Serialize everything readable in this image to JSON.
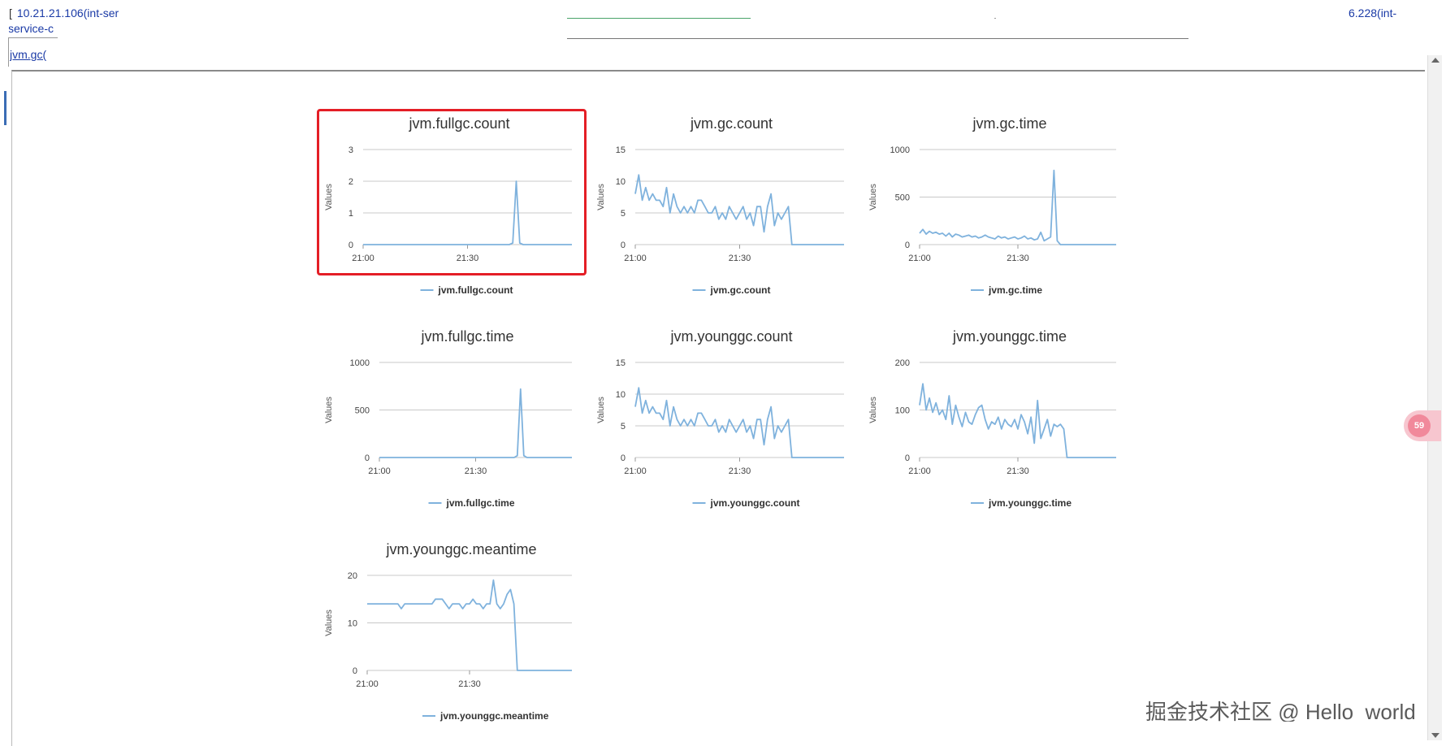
{
  "header": {
    "host_left_bracket": "[",
    "host_left_line1": "10.21.21.106(int-ser",
    "host_left_line2": "service-c",
    "host_right": "6.228(int-",
    "tab_label": "jvm.gc(",
    "side_badge": "59"
  },
  "watermark": "掘金技术社区 @ Hello_world_",
  "colors": {
    "series": "#7fb2dd",
    "grid": "#c8c8c8",
    "highlight": "#e41e26",
    "link": "#1a3aa6"
  },
  "icons": {
    "scroll_up": "triangle-up-icon",
    "scroll_down": "triangle-down-icon",
    "legend": "line-swatch-icon"
  },
  "chart_data": [
    {
      "type": "line",
      "title": "jvm.fullgc.count",
      "ylabel": "Values",
      "legend": "jvm.fullgc.count",
      "ylim": [
        0,
        3
      ],
      "yticks": [
        0,
        1,
        2,
        3
      ],
      "xlim": [
        0,
        60
      ],
      "xticks": [
        "21:00",
        "21:30"
      ],
      "xtick_pos": [
        0,
        30
      ],
      "x": [
        0,
        42,
        43,
        44,
        45,
        46,
        60
      ],
      "values": [
        0,
        0,
        0.05,
        2,
        0.05,
        0,
        0
      ]
    },
    {
      "type": "line",
      "title": "jvm.gc.count",
      "ylabel": "Values",
      "legend": "jvm.gc.count",
      "ylim": [
        0,
        15
      ],
      "yticks": [
        0,
        5,
        10,
        15
      ],
      "xlim": [
        0,
        60
      ],
      "xticks": [
        "21:00",
        "21:30"
      ],
      "xtick_pos": [
        0,
        30
      ],
      "x": [
        0,
        1,
        2,
        3,
        4,
        5,
        6,
        7,
        8,
        9,
        10,
        11,
        12,
        13,
        14,
        15,
        16,
        17,
        18,
        19,
        20,
        21,
        22,
        23,
        24,
        25,
        26,
        27,
        28,
        29,
        30,
        31,
        32,
        33,
        34,
        35,
        36,
        37,
        38,
        39,
        40,
        41,
        42,
        43,
        44,
        45,
        60
      ],
      "values": [
        8,
        11,
        7,
        9,
        7,
        8,
        7,
        7,
        6,
        9,
        5,
        8,
        6,
        5,
        6,
        5,
        6,
        5,
        7,
        7,
        6,
        5,
        5,
        6,
        4,
        5,
        4,
        6,
        5,
        4,
        5,
        6,
        4,
        5,
        3,
        6,
        6,
        2,
        6,
        8,
        3,
        5,
        4,
        5,
        6,
        0,
        0
      ]
    },
    {
      "type": "line",
      "title": "jvm.gc.time",
      "ylabel": "Values",
      "legend": "jvm.gc.time",
      "ylim": [
        0,
        1000
      ],
      "yticks": [
        0,
        500,
        1000
      ],
      "xlim": [
        0,
        60
      ],
      "xticks": [
        "21:00",
        "21:30"
      ],
      "xtick_pos": [
        0,
        30
      ],
      "x": [
        0,
        1,
        2,
        3,
        4,
        5,
        6,
        7,
        8,
        9,
        10,
        11,
        12,
        13,
        14,
        15,
        16,
        17,
        18,
        19,
        20,
        21,
        22,
        23,
        24,
        25,
        26,
        27,
        28,
        29,
        30,
        31,
        32,
        33,
        34,
        35,
        36,
        37,
        38,
        39,
        40,
        41,
        42,
        43,
        60
      ],
      "values": [
        120,
        160,
        110,
        140,
        120,
        130,
        110,
        120,
        90,
        120,
        80,
        110,
        100,
        80,
        90,
        100,
        80,
        90,
        70,
        80,
        100,
        80,
        70,
        60,
        90,
        70,
        80,
        60,
        70,
        80,
        60,
        70,
        90,
        60,
        70,
        50,
        60,
        130,
        40,
        60,
        80,
        780,
        40,
        0,
        0
      ]
    },
    {
      "type": "line",
      "title": "jvm.fullgc.time",
      "ylabel": "Values",
      "legend": "jvm.fullgc.time",
      "ylim": [
        0,
        1000
      ],
      "yticks": [
        0,
        500,
        1000
      ],
      "xlim": [
        0,
        60
      ],
      "xticks": [
        "21:00",
        "21:30"
      ],
      "xtick_pos": [
        0,
        30
      ],
      "x": [
        0,
        42,
        43,
        44,
        45,
        46,
        60
      ],
      "values": [
        0,
        0,
        20,
        720,
        20,
        0,
        0
      ]
    },
    {
      "type": "line",
      "title": "jvm.younggc.count",
      "ylabel": "Values",
      "legend": "jvm.younggc.count",
      "ylim": [
        0,
        15
      ],
      "yticks": [
        0,
        5,
        10,
        15
      ],
      "xlim": [
        0,
        60
      ],
      "xticks": [
        "21:00",
        "21:30"
      ],
      "xtick_pos": [
        0,
        30
      ],
      "x": [
        0,
        1,
        2,
        3,
        4,
        5,
        6,
        7,
        8,
        9,
        10,
        11,
        12,
        13,
        14,
        15,
        16,
        17,
        18,
        19,
        20,
        21,
        22,
        23,
        24,
        25,
        26,
        27,
        28,
        29,
        30,
        31,
        32,
        33,
        34,
        35,
        36,
        37,
        38,
        39,
        40,
        41,
        42,
        43,
        44,
        45,
        60
      ],
      "values": [
        8,
        11,
        7,
        9,
        7,
        8,
        7,
        7,
        6,
        9,
        5,
        8,
        6,
        5,
        6,
        5,
        6,
        5,
        7,
        7,
        6,
        5,
        5,
        6,
        4,
        5,
        4,
        6,
        5,
        4,
        5,
        6,
        4,
        5,
        3,
        6,
        6,
        2,
        6,
        8,
        3,
        5,
        4,
        5,
        6,
        0,
        0
      ]
    },
    {
      "type": "line",
      "title": "jvm.younggc.time",
      "ylabel": "Values",
      "legend": "jvm.younggc.time",
      "ylim": [
        0,
        200
      ],
      "yticks": [
        0,
        100,
        200
      ],
      "xlim": [
        0,
        60
      ],
      "xticks": [
        "21:00",
        "21:30"
      ],
      "xtick_pos": [
        0,
        30
      ],
      "x": [
        0,
        1,
        2,
        3,
        4,
        5,
        6,
        7,
        8,
        9,
        10,
        11,
        12,
        13,
        14,
        15,
        16,
        17,
        18,
        19,
        20,
        21,
        22,
        23,
        24,
        25,
        26,
        27,
        28,
        29,
        30,
        31,
        32,
        33,
        34,
        35,
        36,
        37,
        38,
        39,
        40,
        41,
        42,
        43,
        44,
        45,
        60
      ],
      "values": [
        110,
        155,
        100,
        125,
        95,
        115,
        90,
        100,
        80,
        130,
        70,
        110,
        85,
        65,
        95,
        75,
        70,
        90,
        105,
        110,
        80,
        60,
        75,
        70,
        85,
        60,
        80,
        70,
        65,
        80,
        60,
        90,
        75,
        50,
        85,
        30,
        120,
        40,
        60,
        80,
        45,
        70,
        65,
        70,
        60,
        0,
        0
      ]
    },
    {
      "type": "line",
      "title": "jvm.younggc.meantime",
      "ylabel": "Values",
      "legend": "jvm.younggc.meantime",
      "ylim": [
        0,
        20
      ],
      "yticks": [
        0,
        10,
        20
      ],
      "xlim": [
        0,
        60
      ],
      "xticks": [
        "21:00",
        "21:30"
      ],
      "xtick_pos": [
        0,
        30
      ],
      "x": [
        0,
        9,
        10,
        11,
        19,
        20,
        21,
        22,
        23,
        24,
        25,
        26,
        27,
        28,
        29,
        30,
        31,
        32,
        33,
        34,
        35,
        36,
        37,
        38,
        39,
        40,
        41,
        42,
        43,
        44,
        45,
        60
      ],
      "values": [
        14,
        14,
        13,
        14,
        14,
        15,
        15,
        15,
        14,
        13,
        14,
        14,
        14,
        13,
        14,
        14,
        15,
        14,
        14,
        13,
        14,
        14,
        19,
        14,
        13,
        14,
        16,
        17,
        14,
        0,
        0,
        0
      ]
    }
  ]
}
